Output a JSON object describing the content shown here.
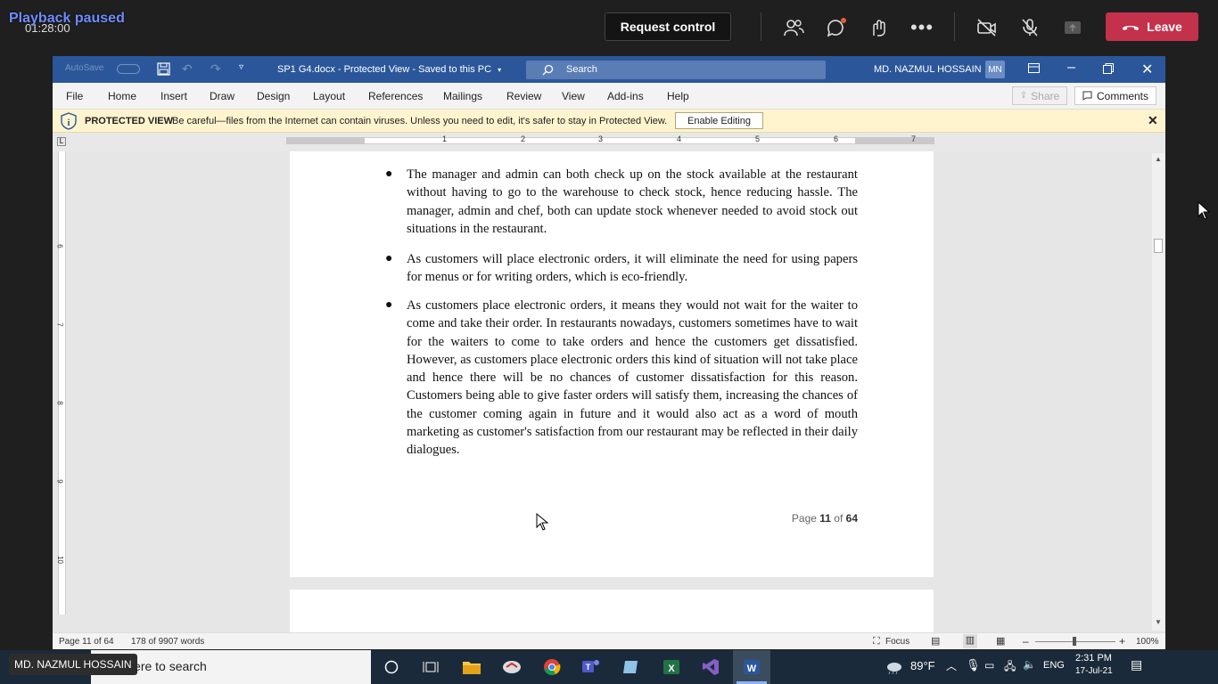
{
  "teams": {
    "playback": "Playback paused",
    "time": "01:28:00",
    "request_control": "Request control",
    "leave": "Leave",
    "participant_name": "MD. NAZMUL HOSSAIN"
  },
  "word": {
    "autosave": "AutoSave",
    "doc_title": "SP1 G4.docx  -  Protected View  -  Saved to this PC",
    "search_placeholder": "Search",
    "user_name": "MD. NAZMUL HOSSAIN",
    "user_initials": "MN",
    "ribbon_tabs": [
      "File",
      "Home",
      "Insert",
      "Draw",
      "Design",
      "Layout",
      "References",
      "Mailings",
      "Review",
      "View",
      "Add-ins",
      "Help"
    ],
    "share": "Share",
    "comments": "Comments",
    "protected_view": {
      "title": "PROTECTED VIEW",
      "message": "Be careful—files from the Internet can contain viruses. Unless you need to edit, it's safer to stay in Protected View.",
      "button": "Enable Editing"
    },
    "ruler_numbers": [
      "1",
      "2",
      "3",
      "4",
      "5",
      "6",
      "7"
    ],
    "vruler_numbers": [
      "6",
      "7",
      "8",
      "9",
      "10"
    ],
    "document": {
      "bullets": [
        "The manager and admin can both check up on the stock available at the restaurant without having to go to the warehouse to check stock, hence reducing hassle. The manager, admin and chef, both can update stock whenever needed to avoid stock out situations in the restaurant.",
        "As customers will place electronic orders, it will eliminate the need for using papers for menus or for writing orders, which is eco-friendly.",
        "As customers place electronic orders, it means they would not wait for the waiter to come and take their order. In restaurants nowadays, customers sometimes have to wait for the waiters to come to take orders and hence the customers get dissatisfied. However, as customers place electronic orders this kind of situation will not take place and hence there will be no chances of customer dissatisfaction for this reason. Customers being able to give faster orders will satisfy them, increasing the chances of the customer coming again in future and it would also act as a word of mouth marketing as customer's satisfaction from our restaurant may be reflected in their daily dialogues."
      ],
      "footer_prefix": "Page ",
      "footer_page": "11",
      "footer_mid": " of ",
      "footer_total": "64"
    },
    "status": {
      "page": "Page 11 of 64",
      "words": "178 of 9907 words",
      "focus": "Focus",
      "zoom": "100%"
    }
  },
  "taskbar": {
    "search_placeholder": "Type here to search",
    "weather": "89°F",
    "language": "ENG",
    "time": "2:31 PM",
    "date": "17-Jul-21"
  },
  "colors": {
    "word_blue": "#2b579a",
    "leave_red": "#c4314b",
    "protected_yellow": "#fff4ce"
  }
}
